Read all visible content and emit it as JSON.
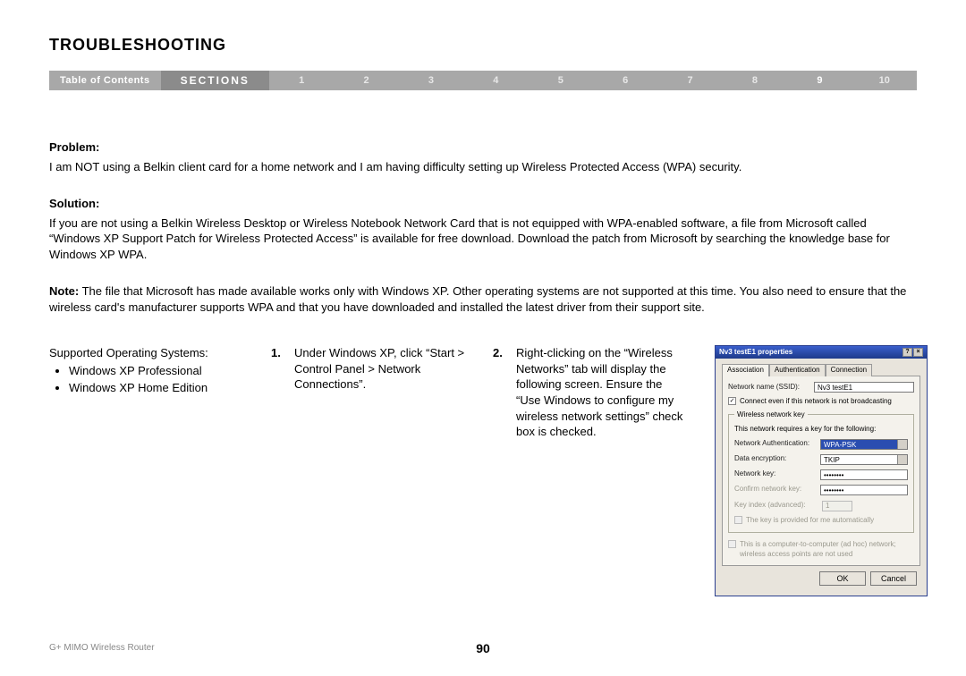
{
  "title": "TROUBLESHOOTING",
  "nav": {
    "toc": "Table of Contents",
    "sections_label": "SECTIONS",
    "items": [
      "1",
      "2",
      "3",
      "4",
      "5",
      "6",
      "7",
      "8",
      "9",
      "10"
    ],
    "active_index": 8
  },
  "problem": {
    "label": "Problem:",
    "text": "I am NOT using a Belkin client card for a home network and I am having difficulty setting up Wireless Protected Access (WPA) security."
  },
  "solution": {
    "label": "Solution:",
    "text": "If you are not using a Belkin Wireless Desktop or Wireless Notebook Network Card that is not equipped with WPA-enabled software, a file from Microsoft called “Windows XP Support Patch for Wireless Protected Access” is available for free download. Download the patch from Microsoft by searching the knowledge base for Windows XP WPA."
  },
  "note": {
    "label": "Note:",
    "text": " The file that Microsoft has made available works only with Windows XP. Other operating systems are not supported at this time. You also need to ensure that the wireless card's manufacturer supports WPA and that you have downloaded and installed the latest driver from their support site."
  },
  "supported_os": {
    "title": "Supported Operating Systems:",
    "items": [
      "Windows XP Professional",
      "Windows XP Home Edition"
    ]
  },
  "steps": [
    {
      "num": "1.",
      "text": "Under Windows XP, click “Start > Control Panel > Network Connections”."
    },
    {
      "num": "2.",
      "text": "Right-clicking on the “Wireless Networks” tab will display the following screen. Ensure the “Use Windows to configure my wireless network settings” check box is checked."
    }
  ],
  "dialog": {
    "title": "Nv3 testE1 properties",
    "tabs": [
      "Association",
      "Authentication",
      "Connection"
    ],
    "ssid_label": "Network name (SSID):",
    "ssid_value": "Nv3 testE1",
    "connect_even": "Connect even if this network is not broadcasting",
    "key_fieldset": "Wireless network key",
    "key_desc": "This network requires a key for the following:",
    "auth_label": "Network Authentication:",
    "auth_value": "WPA-PSK",
    "enc_label": "Data encryption:",
    "enc_value": "TKIP",
    "netkey_label": "Network key:",
    "netkey_value": "••••••••",
    "confirm_label": "Confirm network key:",
    "confirm_value": "••••••••",
    "keyidx_label": "Key index (advanced):",
    "keyidx_value": "1",
    "auto_key": "The key is provided for me automatically",
    "adhoc": "This is a computer-to-computer (ad hoc) network; wireless access points are not used",
    "ok": "OK",
    "cancel": "Cancel"
  },
  "footer": {
    "product": "G+ MIMO Wireless Router",
    "page": "90"
  }
}
